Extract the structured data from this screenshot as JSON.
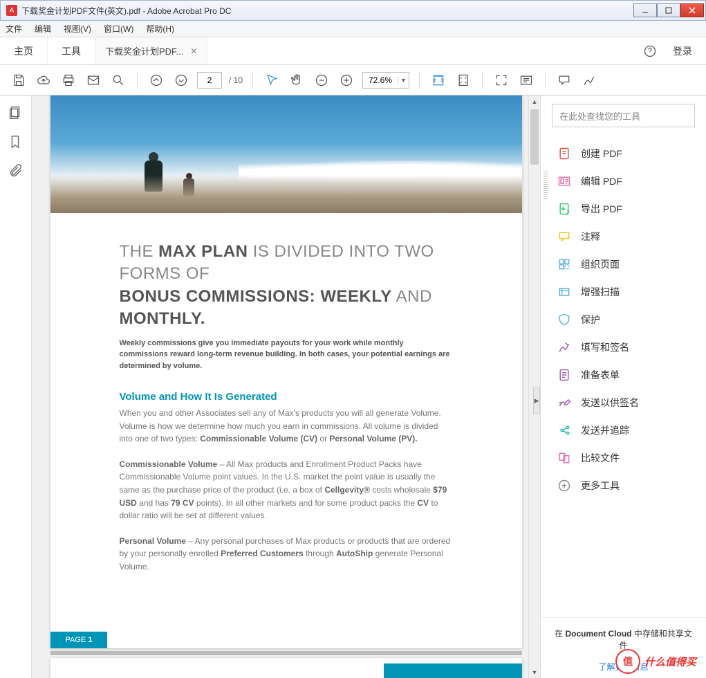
{
  "window": {
    "title": "下载奖金计划PDF文件(英文).pdf - Adobe Acrobat Pro DC"
  },
  "menu": {
    "file": "文件",
    "edit": "编辑",
    "view": "视图(V)",
    "window": "窗口(W)",
    "help": "帮助(H)"
  },
  "tabs": {
    "home": "主页",
    "tools": "工具",
    "doc": "下载奖金计划PDF...",
    "login": "登录"
  },
  "toolbar": {
    "page_current": "2",
    "page_total": "/ 10",
    "zoom": "72.6%"
  },
  "right": {
    "search_placeholder": "在此处查找您的工具",
    "tools": [
      {
        "label": "创建 PDF",
        "color": "#e74c3c"
      },
      {
        "label": "编辑 PDF",
        "color": "#e86db0"
      },
      {
        "label": "导出 PDF",
        "color": "#2ecc71"
      },
      {
        "label": "注释",
        "color": "#f1c40f"
      },
      {
        "label": "组织页面",
        "color": "#5dade2"
      },
      {
        "label": "增强扫描",
        "color": "#5dade2"
      },
      {
        "label": "保护",
        "color": "#5dade2"
      },
      {
        "label": "填写和签名",
        "color": "#9b59b6"
      },
      {
        "label": "准备表单",
        "color": "#9b59b6"
      },
      {
        "label": "发送以供签名",
        "color": "#9b59b6"
      },
      {
        "label": "发送并追踪",
        "color": "#1abc9c"
      },
      {
        "label": "比较文件",
        "color": "#e86db0"
      },
      {
        "label": "更多工具",
        "color": "#888"
      }
    ],
    "cloud_pre": "在 ",
    "cloud_b": "Document Cloud",
    "cloud_post": " 中存储和共享文件",
    "more_link": "了解更多信息"
  },
  "doc": {
    "h1_parts": [
      "THE ",
      "MAX PLAN",
      " IS DIVIDED INTO TWO FORMS OF ",
      "BONUS COMMISSIONS: WEEKLY",
      " AND ",
      "MONTHLY."
    ],
    "sub": "Weekly commissions give you immediate payouts for your work while monthly commissions reward long-term revenue building. In both cases, your potential earnings are determined by volume.",
    "h2": "Volume and How It Is Generated",
    "p1": "When you and other Associates sell any of Max's products you will all generate Volume. Volume is how we determine how much you earn in commissions. All volume is divided into one of two types: ",
    "p1_b1": "Commissionable Volume (CV)",
    "p1_mid": " or ",
    "p1_b2": "Personal Volume (PV).",
    "p2_b1": "Commissionable Volume",
    "p2_a": " – All Max products and Enrollment Product Packs have Commissionable Volume point values. In the U.S. market the point value is usually the same as the purchase price of the product (i.e. a box of ",
    "p2_b2": "Cellgevity®",
    "p2_b": " costs wholesale ",
    "p2_b3": "$79 USD",
    "p2_c": " and has ",
    "p2_b4": "79 CV",
    "p2_d": " points). In all other markets and for some product packs the ",
    "p2_b5": "CV",
    "p2_e": " to dollar ratio will be set at different values.",
    "p3_b1": "Personal Volume",
    "p3_a": " – Any personal purchases of Max products or products that are ordered by your personally enrolled ",
    "p3_b2": "Preferred Customers",
    "p3_b": " through ",
    "p3_b3": "AutoShip",
    "p3_c": " generate Personal Volume.",
    "page_label": "PAGE ",
    "page_num": "1"
  },
  "watermark": {
    "icon": "值",
    "text": "什么值得买"
  }
}
